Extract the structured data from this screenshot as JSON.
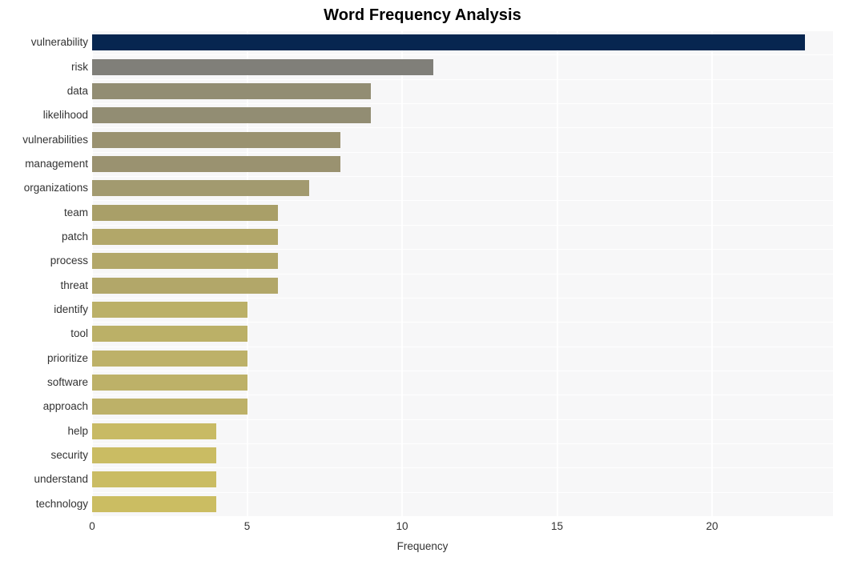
{
  "chart_data": {
    "type": "bar",
    "orientation": "horizontal",
    "title": "Word Frequency Analysis",
    "xlabel": "Frequency",
    "ylabel": "",
    "xlim": [
      0,
      23.9
    ],
    "xticks": [
      0,
      5,
      10,
      15,
      20
    ],
    "xtick_labels": [
      "0",
      "5",
      "10",
      "15",
      "20"
    ],
    "grid": true,
    "legend": false,
    "categories": [
      "vulnerability",
      "risk",
      "data",
      "likelihood",
      "vulnerabilities",
      "management",
      "organizations",
      "team",
      "patch",
      "process",
      "threat",
      "identify",
      "tool",
      "prioritize",
      "software",
      "approach",
      "help",
      "security",
      "understand",
      "technology"
    ],
    "values": [
      23,
      11,
      9,
      9,
      8,
      8,
      7,
      6,
      6,
      6,
      6,
      5,
      5,
      5,
      5,
      5,
      4,
      4,
      4,
      4
    ],
    "bar_colors": [
      "#072650",
      "#807f79",
      "#928d73",
      "#928d73",
      "#9a9270",
      "#9a9270",
      "#a29a6f",
      "#a99f68",
      "#b2a769",
      "#b2a769",
      "#b2a769",
      "#bbb067",
      "#bbb067",
      "#bdb168",
      "#bdb168",
      "#bdb168",
      "#c8ba64",
      "#cabc63",
      "#cabc63",
      "#cbbd62"
    ],
    "plot_background": "#f7f7f8",
    "grid_color": "#ffffff",
    "text_color": "#333333",
    "title_color": "#000000"
  }
}
